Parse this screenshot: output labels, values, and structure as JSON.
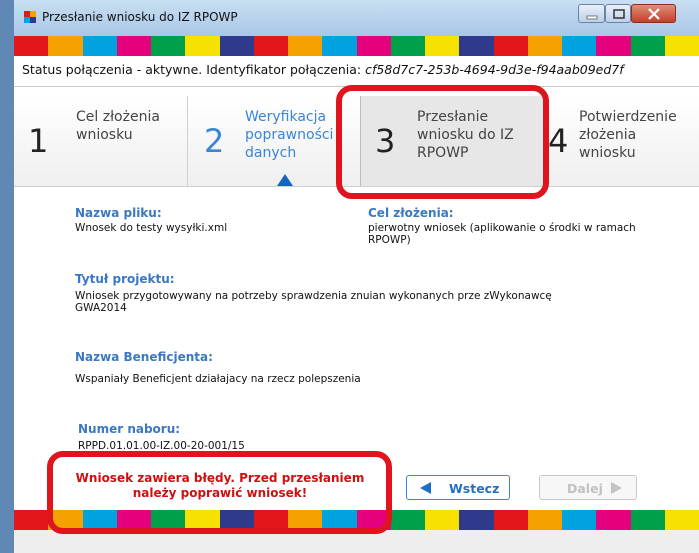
{
  "window": {
    "title": "Przesłanie wniosku do IZ RPOWP"
  },
  "colors": {
    "stripe": [
      "#e3161b",
      "#f5a200",
      "#00a3e0",
      "#e5007e",
      "#00a04a",
      "#f7e100",
      "#2e3a8c",
      "#e3161b",
      "#f5a200",
      "#00a3e0",
      "#e5007e",
      "#00a04a",
      "#f7e100",
      "#2e3a8c",
      "#e3161b",
      "#f5a200",
      "#00a3e0",
      "#e5007e",
      "#00a04a",
      "#f7e100"
    ],
    "highlight": "#e0141f",
    "accent": "#3b78c3",
    "error": "#cc1111"
  },
  "status": {
    "label": "Status połączenia - aktywne. Identyfikator połączenia:",
    "connection_id": "cf58d7c7-253b-4694-9d3e-f94aab09ed7f"
  },
  "steps": [
    {
      "number": "1",
      "label": "Cel złożenia wniosku",
      "state": "done"
    },
    {
      "number": "2",
      "label": "Weryfikacja poprawności danych",
      "state": "active"
    },
    {
      "number": "3",
      "label": "Przesłanie wniosku do IZ RPOWP",
      "state": "current"
    },
    {
      "number": "4",
      "label": "Potwierdzenie złożenia wniosku",
      "state": "pending"
    }
  ],
  "fields": {
    "file_name": {
      "label": "Nazwa pliku:",
      "value": "Wnosek do testy wysyłki.xml"
    },
    "purpose": {
      "label": "Cel złożenia:",
      "value": "pierwotny wniosek (aplikowanie o środki w ramach RPOWP)"
    },
    "project_title": {
      "label": "Tytuł projektu:",
      "value": "Wniosek przygotowywany na potrzeby sprawdzenia znuian wykonanych prze zWykonawcę GWA2014"
    },
    "beneficiary": {
      "label": "Nazwa Beneficjenta:",
      "value": "Wspaniały Beneficjent działajacy na rzecz polepszenia"
    },
    "call_number": {
      "label": "Numer naboru:",
      "value": "RPPD.01.01.00-IZ.00-20-001/15"
    }
  },
  "error_message": "Wniosek zawiera błędy. Przed przesłaniem należy poprawić wniosek!",
  "buttons": {
    "back": "Wstecz",
    "next": "Dalej"
  },
  "icons": {
    "app": "app-icon",
    "back": "arrow-left-icon",
    "next": "arrow-right-icon"
  }
}
